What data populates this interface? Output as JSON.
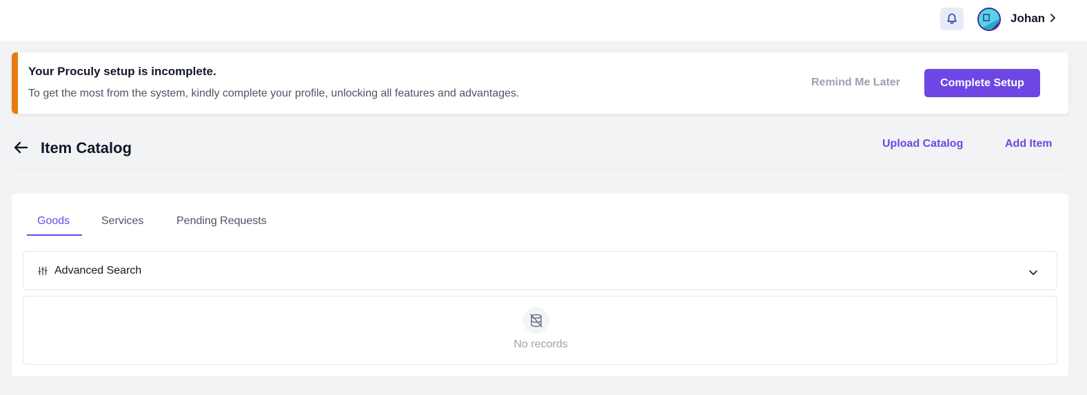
{
  "topbar": {
    "user_name": "Johan",
    "icons": {
      "bell": "bell-icon",
      "chevron": "chevron-right-icon"
    }
  },
  "banner": {
    "title": "Your Proculy setup is incomplete.",
    "message": "To get the most from the system, kindly complete your profile, unlocking all features and advantages.",
    "remind_label": "Remind Me Later",
    "complete_label": "Complete Setup",
    "accent_color": "#e8790f"
  },
  "page": {
    "title": "Item Catalog",
    "upload_label": "Upload Catalog",
    "add_label": "Add Item"
  },
  "tabs": [
    {
      "label": "Goods",
      "active": true
    },
    {
      "label": "Services",
      "active": false
    },
    {
      "label": "Pending Requests",
      "active": false
    }
  ],
  "advanced_search": {
    "label": "Advanced Search"
  },
  "records": {
    "empty_text": "No records"
  },
  "colors": {
    "brand": "#6d46e3",
    "background": "#f2f3f5"
  }
}
